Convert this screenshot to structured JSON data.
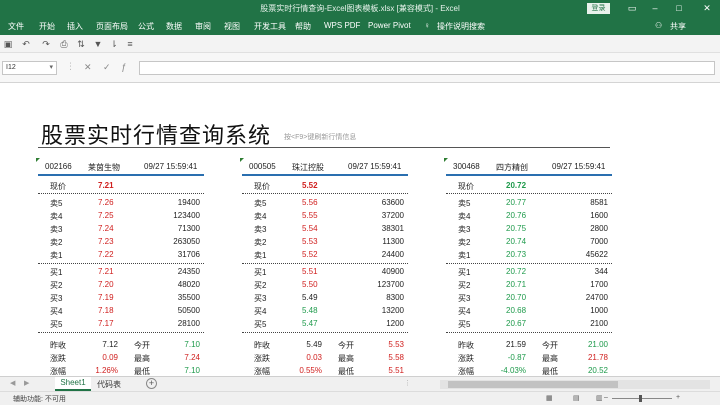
{
  "window": {
    "title": "股票实时行情查询-Excel图表模板.xlsx [兼容模式] - Excel",
    "login": "登录"
  },
  "menu": [
    {
      "label": "文件"
    },
    {
      "label": "开始"
    },
    {
      "label": "插入"
    },
    {
      "label": "页面布局"
    },
    {
      "label": "公式"
    },
    {
      "label": "数据"
    },
    {
      "label": "审阅"
    },
    {
      "label": "视图"
    },
    {
      "label": "开发工具"
    },
    {
      "label": "帮助"
    },
    {
      "label": "WPS PDF"
    },
    {
      "label": "Power Pivot"
    },
    {
      "label": "操作说明搜索"
    }
  ],
  "share_label": "共享",
  "namebox": {
    "value": "I12"
  },
  "sheet": {
    "title": "股票实时行情查询系统",
    "hint": "按<F9>键刷新行情信息"
  },
  "panels": [
    {
      "code": "002166",
      "name": "莱茵生物",
      "time": "09/27 15:59:41",
      "current_label": "现价",
      "current": "7.21",
      "current_color": "#d0201f",
      "sell": [
        {
          "label": "卖5",
          "price": "7.26",
          "volume": "19400",
          "color": "#d0201f"
        },
        {
          "label": "卖4",
          "price": "7.25",
          "volume": "123400",
          "color": "#d0201f"
        },
        {
          "label": "卖3",
          "price": "7.24",
          "volume": "71300",
          "color": "#d0201f"
        },
        {
          "label": "卖2",
          "price": "7.23",
          "volume": "263050",
          "color": "#d0201f"
        },
        {
          "label": "卖1",
          "price": "7.22",
          "volume": "31706",
          "color": "#d0201f"
        }
      ],
      "buy": [
        {
          "label": "买1",
          "price": "7.21",
          "volume": "24350",
          "color": "#d0201f"
        },
        {
          "label": "买2",
          "price": "7.20",
          "volume": "48020",
          "color": "#d0201f"
        },
        {
          "label": "买3",
          "price": "7.19",
          "volume": "35500",
          "color": "#d0201f"
        },
        {
          "label": "买4",
          "price": "7.18",
          "volume": "50500",
          "color": "#d0201f"
        },
        {
          "label": "买5",
          "price": "7.17",
          "volume": "28100",
          "color": "#d0201f"
        }
      ],
      "stats": [
        {
          "l1": "昨收",
          "v1": "7.12",
          "c1": "#222222",
          "l2": "今开",
          "v2": "7.10",
          "c2": "#1e9a4b"
        },
        {
          "l1": "涨跌",
          "v1": "0.09",
          "c1": "#d0201f",
          "l2": "最高",
          "v2": "7.24",
          "c2": "#d0201f"
        },
        {
          "l1": "涨幅",
          "v1": "1.26%",
          "c1": "#d0201f",
          "l2": "最低",
          "v2": "7.10",
          "c2": "#1e9a4b"
        }
      ]
    },
    {
      "code": "000505",
      "name": "珠江控股",
      "time": "09/27 15:59:41",
      "current_label": "现价",
      "current": "5.52",
      "current_color": "#d0201f",
      "sell": [
        {
          "label": "卖5",
          "price": "5.56",
          "volume": "63600",
          "color": "#d0201f"
        },
        {
          "label": "卖4",
          "price": "5.55",
          "volume": "37200",
          "color": "#d0201f"
        },
        {
          "label": "卖3",
          "price": "5.54",
          "volume": "38301",
          "color": "#d0201f"
        },
        {
          "label": "卖2",
          "price": "5.53",
          "volume": "11300",
          "color": "#d0201f"
        },
        {
          "label": "卖1",
          "price": "5.52",
          "volume": "24400",
          "color": "#d0201f"
        }
      ],
      "buy": [
        {
          "label": "买1",
          "price": "5.51",
          "volume": "40900",
          "color": "#d0201f"
        },
        {
          "label": "买2",
          "price": "5.50",
          "volume": "123700",
          "color": "#d0201f"
        },
        {
          "label": "买3",
          "price": "5.49",
          "volume": "8300",
          "color": "#222222"
        },
        {
          "label": "买4",
          "price": "5.48",
          "volume": "13200",
          "color": "#1e9a4b"
        },
        {
          "label": "买5",
          "price": "5.47",
          "volume": "1200",
          "color": "#1e9a4b"
        }
      ],
      "stats": [
        {
          "l1": "昨收",
          "v1": "5.49",
          "c1": "#222222",
          "l2": "今开",
          "v2": "5.53",
          "c2": "#d0201f"
        },
        {
          "l1": "涨跌",
          "v1": "0.03",
          "c1": "#d0201f",
          "l2": "最高",
          "v2": "5.58",
          "c2": "#d0201f"
        },
        {
          "l1": "涨幅",
          "v1": "0.55%",
          "c1": "#d0201f",
          "l2": "最低",
          "v2": "5.51",
          "c2": "#d0201f"
        }
      ]
    },
    {
      "code": "300468",
      "name": "四方精创",
      "time": "09/27 15:59:41",
      "current_label": "现价",
      "current": "20.72",
      "current_color": "#1e9a4b",
      "sell": [
        {
          "label": "卖5",
          "price": "20.77",
          "volume": "8581",
          "color": "#1e9a4b"
        },
        {
          "label": "卖4",
          "price": "20.76",
          "volume": "1600",
          "color": "#1e9a4b"
        },
        {
          "label": "卖3",
          "price": "20.75",
          "volume": "2800",
          "color": "#1e9a4b"
        },
        {
          "label": "卖2",
          "price": "20.74",
          "volume": "7000",
          "color": "#1e9a4b"
        },
        {
          "label": "卖1",
          "price": "20.73",
          "volume": "45622",
          "color": "#1e9a4b"
        }
      ],
      "buy": [
        {
          "label": "买1",
          "price": "20.72",
          "volume": "344",
          "color": "#1e9a4b"
        },
        {
          "label": "买2",
          "price": "20.71",
          "volume": "1700",
          "color": "#1e9a4b"
        },
        {
          "label": "买3",
          "price": "20.70",
          "volume": "24700",
          "color": "#1e9a4b"
        },
        {
          "label": "买4",
          "price": "20.68",
          "volume": "1000",
          "color": "#1e9a4b"
        },
        {
          "label": "买5",
          "price": "20.67",
          "volume": "2100",
          "color": "#1e9a4b"
        }
      ],
      "stats": [
        {
          "l1": "昨收",
          "v1": "21.59",
          "c1": "#222222",
          "l2": "今开",
          "v2": "21.00",
          "c2": "#1e9a4b"
        },
        {
          "l1": "涨跌",
          "v1": "-0.87",
          "c1": "#1e9a4b",
          "l2": "最高",
          "v2": "21.78",
          "c2": "#d0201f"
        },
        {
          "l1": "涨幅",
          "v1": "-4.03%",
          "c1": "#1e9a4b",
          "l2": "最低",
          "v2": "20.52",
          "c2": "#1e9a4b"
        }
      ]
    }
  ],
  "tabs": {
    "active": "Sheet1",
    "other": "代码表"
  },
  "status": {
    "accessibility": "辅助功能: 不可用"
  }
}
